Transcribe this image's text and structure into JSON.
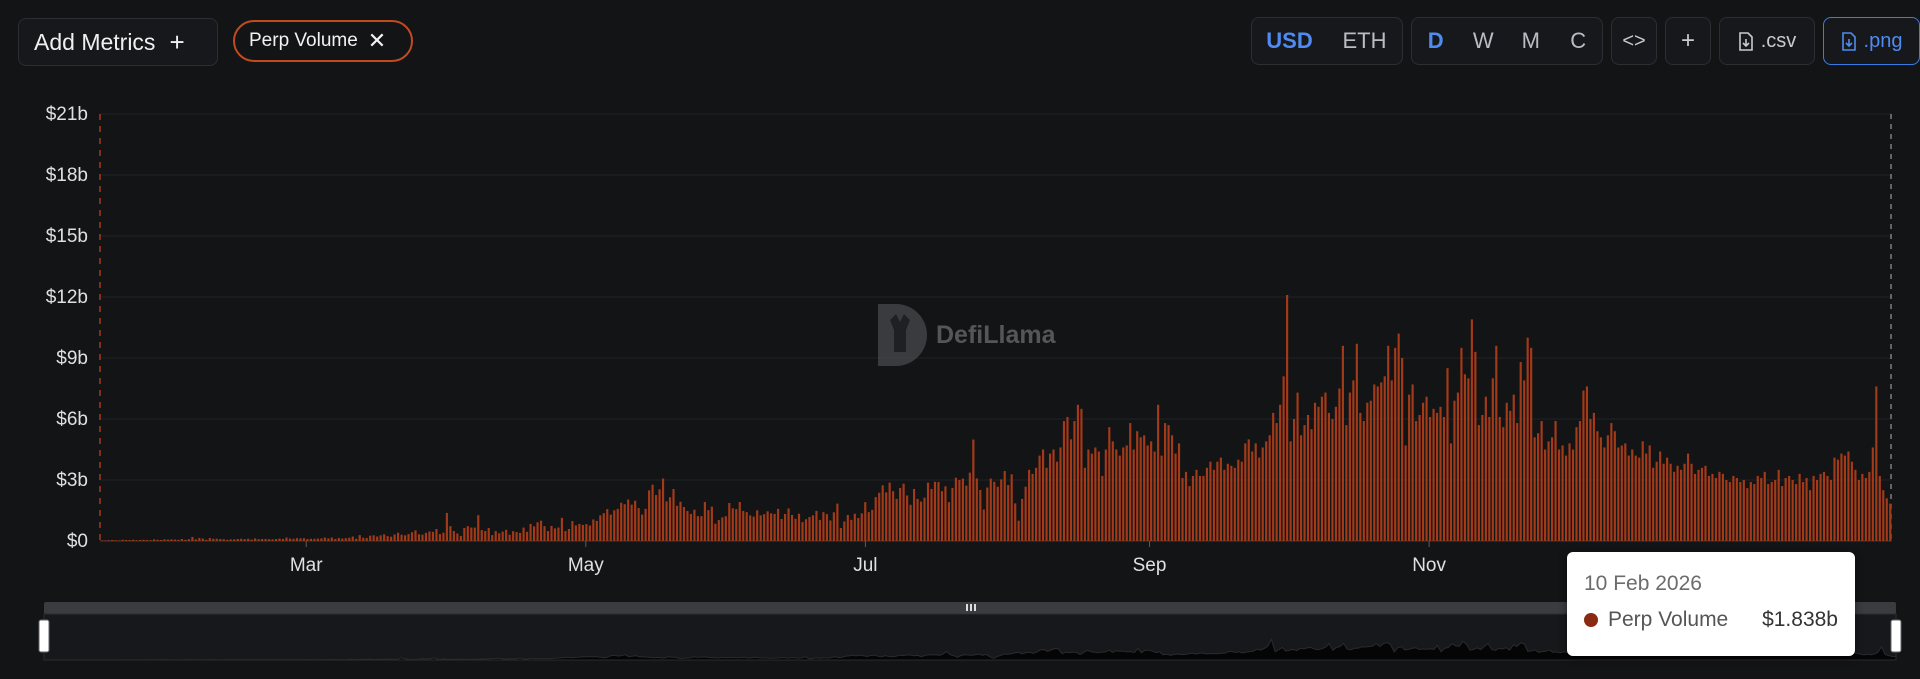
{
  "toolbar": {
    "add_metrics_label": "Add Metrics",
    "add_metrics_icon": "plus-icon",
    "metric_chip_label": "Perp Volume",
    "metric_chip_icon": "close-icon",
    "currency_options": [
      "USD",
      "ETH"
    ],
    "currency_selected": "USD",
    "granularity_options": [
      "D",
      "W",
      "M",
      "C"
    ],
    "granularity_selected": "D",
    "embed_icon": "code-icon",
    "add_icon": "plus-icon",
    "csv_label": ".csv",
    "png_label": ".png",
    "download_icon": "file-download-icon",
    "active_color": "#4f8bf0",
    "chip_color": "#c24a1f"
  },
  "watermark": {
    "text": "DefiLlama"
  },
  "tooltip": {
    "date": "10 Feb 2026",
    "series_name": "Perp Volume",
    "value": "$1.838b"
  },
  "chart_data": {
    "type": "bar",
    "color": "#a33a18",
    "y_axis_unit": "billion USD",
    "ylim": [
      0,
      21
    ],
    "y_ticks": [
      {
        "value": 0,
        "label": "$0"
      },
      {
        "value": 3,
        "label": "$3b"
      },
      {
        "value": 6,
        "label": "$6b"
      },
      {
        "value": 9,
        "label": "$9b"
      },
      {
        "value": 12,
        "label": "$12b"
      },
      {
        "value": 15,
        "label": "$15b"
      },
      {
        "value": 18,
        "label": "$18b"
      },
      {
        "value": 21,
        "label": "$21b"
      }
    ],
    "x_start": "2025-01-15",
    "x_end": "2026-02-10",
    "x_ticks": [
      {
        "date": "2025-03-01",
        "label": "Mar"
      },
      {
        "date": "2025-05-01",
        "label": "May"
      },
      {
        "date": "2025-07-01",
        "label": "Jul"
      },
      {
        "date": "2025-09-01",
        "label": "Sep"
      },
      {
        "date": "2025-11-01",
        "label": "Nov"
      }
    ],
    "grid": true,
    "legend": "none",
    "series": [
      {
        "name": "Perp Volume",
        "values": [
          0.03,
          0.03,
          0.04,
          0.05,
          0.04,
          0.03,
          0.06,
          0.05,
          0.05,
          0.06,
          0.04,
          0.05,
          0.06,
          0.05,
          0.04,
          0.08,
          0.06,
          0.05,
          0.08,
          0.07,
          0.08,
          0.07,
          0.06,
          0.1,
          0.06,
          0.09,
          0.2,
          0.08,
          0.15,
          0.12,
          0.06,
          0.15,
          0.11,
          0.11,
          0.1,
          0.09,
          0.06,
          0.08,
          0.08,
          0.1,
          0.11,
          0.09,
          0.11,
          0.07,
          0.13,
          0.09,
          0.1,
          0.1,
          0.09,
          0.08,
          0.1,
          0.12,
          0.1,
          0.17,
          0.12,
          0.11,
          0.14,
          0.13,
          0.14,
          0.1,
          0.11,
          0.11,
          0.12,
          0.13,
          0.17,
          0.13,
          0.17,
          0.1,
          0.15,
          0.12,
          0.14,
          0.16,
          0.22,
          0.11,
          0.29,
          0.16,
          0.15,
          0.26,
          0.28,
          0.22,
          0.28,
          0.33,
          0.24,
          0.21,
          0.32,
          0.41,
          0.31,
          0.28,
          0.34,
          0.43,
          0.52,
          0.33,
          0.31,
          0.4,
          0.47,
          0.45,
          0.59,
          0.34,
          0.41,
          1.38,
          0.73,
          0.49,
          0.37,
          0.25,
          0.64,
          0.73,
          0.66,
          0.66,
          1.27,
          0.54,
          0.49,
          0.64,
          0.29,
          0.49,
          0.38,
          0.46,
          0.55,
          0.31,
          0.48,
          0.44,
          0.4,
          0.66,
          0.45,
          0.84,
          0.72,
          0.92,
          1.0,
          0.73,
          0.49,
          0.74,
          0.62,
          0.66,
          1.14,
          0.49,
          0.59,
          0.98,
          0.77,
          0.84,
          0.79,
          0.83,
          0.76,
          1.06,
          0.99,
          1.26,
          1.37,
          1.57,
          1.3,
          1.51,
          1.58,
          1.88,
          1.81,
          2.04,
          1.79,
          1.98,
          1.62,
          1.3,
          1.58,
          2.49,
          2.77,
          2.26,
          2.54,
          3.07,
          1.95,
          2.15,
          2.56,
          1.73,
          1.93,
          1.67,
          1.48,
          1.33,
          1.54,
          1.22,
          1.22,
          1.92,
          1.52,
          1.69,
          0.85,
          1.03,
          1.16,
          1.22,
          1.87,
          1.61,
          1.57,
          1.92,
          1.48,
          1.42,
          1.26,
          1.2,
          1.51,
          1.26,
          1.32,
          1.46,
          1.36,
          1.33,
          1.58,
          1.08,
          1.33,
          1.6,
          1.28,
          1.09,
          1.34,
          0.93,
          1.07,
          1.18,
          1.26,
          1.48,
          1.04,
          1.42,
          1.32,
          1.01,
          1.41,
          1.84,
          0.64,
          0.96,
          1.28,
          1.04,
          1.34,
          1.13,
          1.36,
          1.91,
          1.42,
          1.53,
          2.16,
          2.37,
          2.74,
          2.39,
          2.87,
          2.45,
          2.07,
          2.61,
          2.82,
          2.24,
          1.78,
          2.56,
          2.07,
          1.94,
          2.13,
          2.87,
          2.56,
          2.91,
          2.9,
          2.45,
          2.69,
          1.91,
          2.61,
          3.11,
          3.0,
          3.07,
          2.72,
          3.36,
          4.99,
          3.08,
          2.51,
          1.55,
          2.63,
          3.07,
          2.91,
          2.67,
          3.03,
          3.44,
          2.75,
          3.28,
          1.85,
          1.0,
          2.07,
          2.67,
          3.5,
          3.3,
          3.6,
          4.2,
          4.5,
          3.6,
          4.3,
          4.5,
          3.9,
          4.6,
          5.9,
          6.1,
          5.0,
          5.9,
          6.7,
          6.5,
          3.6,
          4.5,
          4.3,
          4.6,
          4.4,
          3.2,
          4.5,
          5.6,
          4.9,
          4.5,
          4.2,
          4.6,
          4.7,
          5.8,
          4.5,
          5.4,
          5.1,
          5.2,
          4.7,
          4.9,
          4.4,
          6.7,
          4.2,
          5.8,
          5.7,
          5.2,
          4.3,
          4.8,
          3.1,
          3.4,
          2.7,
          3.2,
          3.5,
          3.2,
          3.2,
          3.6,
          3.9,
          3.5,
          3.9,
          4.1,
          3.5,
          3.8,
          3.7,
          3.6,
          4.0,
          3.9,
          4.8,
          5.0,
          4.4,
          4.8,
          4.1,
          4.6,
          4.9,
          5.2,
          6.3,
          5.8,
          6.7,
          8.1,
          12.1,
          4.9,
          6.0,
          7.3,
          5.2,
          5.7,
          6.2,
          5.5,
          6.8,
          6.6,
          7.1,
          7.3,
          6.3,
          6.0,
          6.6,
          7.5,
          9.6,
          5.7,
          7.3,
          7.9,
          9.7,
          6.3,
          5.9,
          6.8,
          6.9,
          7.7,
          7.6,
          7.8,
          8.1,
          9.6,
          7.9,
          9.5,
          10.2,
          9.0,
          4.7,
          7.2,
          7.7,
          5.9,
          6.2,
          6.8,
          7.1,
          6.1,
          6.5,
          6.3,
          6.6,
          6.1,
          8.5,
          4.8,
          6.9,
          7.3,
          9.5,
          8.2,
          8.0,
          10.9,
          9.3,
          5.7,
          6.2,
          7.1,
          6.1,
          8.0,
          9.6,
          6.1,
          5.6,
          6.8,
          6.4,
          7.2,
          5.8,
          8.8,
          7.9,
          10.0,
          9.5,
          5.1,
          5.3,
          5.9,
          4.5,
          4.9,
          5.1,
          5.9,
          4.5,
          4.7,
          4.2,
          4.8,
          4.5,
          5.6,
          5.9,
          7.4,
          7.6,
          6.0,
          6.3,
          5.4,
          5.1,
          4.6,
          5.2,
          5.8,
          5.4,
          4.6,
          4.7,
          4.8,
          4.2,
          4.5,
          4.2,
          4.1,
          4.9,
          4.3,
          4.7,
          3.6,
          3.9,
          4.4,
          3.8,
          4.1,
          3.8,
          3.4,
          3.7,
          3.5,
          3.8,
          4.3,
          3.8,
          3.3,
          3.5,
          3.6,
          3.7,
          3.2,
          3.3,
          3.1,
          3.4,
          3.3,
          3.0,
          2.9,
          3.2,
          3.1,
          2.9,
          3.0,
          2.6,
          2.9,
          2.8,
          3.2,
          3.1,
          3.4,
          2.8,
          2.9,
          3.0,
          3.5,
          2.7,
          3.1,
          3.2,
          3.0,
          2.8,
          3.3,
          2.9,
          3.1,
          2.5,
          3.2,
          3.0,
          3.3,
          3.4,
          3.2,
          3.0,
          4.1,
          4.0,
          4.3,
          4.2,
          4.4,
          3.9,
          3.5,
          3.0,
          3.3,
          3.1,
          3.4,
          4.6,
          7.6,
          3.2,
          2.5,
          2.1,
          1.84
        ]
      }
    ],
    "brush": {
      "start": "2025-01-15",
      "end": "2026-02-10"
    }
  }
}
